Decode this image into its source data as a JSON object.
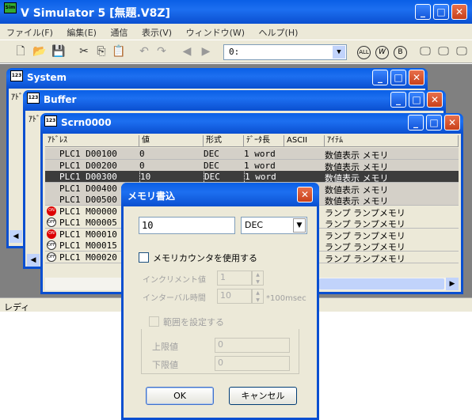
{
  "app": {
    "title": "V Simulator 5 [無題.V8Z]",
    "icon": "Sim"
  },
  "menu": [
    "ファイル(F)",
    "編集(E)",
    "通信",
    "表示(V)",
    "ウィンドウ(W)",
    "ヘルプ(H)"
  ],
  "toolbar": {
    "combo_value": "0:",
    "round_buttons": [
      "ALL",
      "W",
      "B"
    ]
  },
  "windows": {
    "system": "System",
    "buffer": "Buffer",
    "scrn": "Scrn0000"
  },
  "clipped_labels": {
    "system_addr": "ｱﾄﾞ",
    "buffer_addr": "ｱﾄﾞ"
  },
  "table": {
    "headers": [
      "ｱﾄﾞﾚｽ",
      "値",
      "形式",
      "ﾃﾞｰﾀ長",
      "ASCII",
      "ｱｲﾃﾑ"
    ],
    "rows": [
      {
        "addr": "PLC1 D00100",
        "val": "0",
        "fmt": "DEC",
        "len": "1 word",
        "ascii": "",
        "item": "数値表示 メモリ",
        "icon": ""
      },
      {
        "addr": "PLC1 D00200",
        "val": "0",
        "fmt": "DEC",
        "len": "1 word",
        "ascii": "",
        "item": "数値表示 メモリ",
        "icon": ""
      },
      {
        "addr": "PLC1 D00300",
        "val": "10",
        "fmt": "DEC",
        "len": "1 word",
        "ascii": "",
        "item": "数値表示 メモリ",
        "icon": "",
        "selected": true
      },
      {
        "addr": "PLC1 D00400",
        "val": "",
        "fmt": "",
        "len": "",
        "ascii": "",
        "item": "数値表示 メモリ",
        "icon": ""
      },
      {
        "addr": "PLC1 D00500",
        "val": "",
        "fmt": "",
        "len": "",
        "ascii": "",
        "item": "数値表示 メモリ",
        "icon": ""
      },
      {
        "addr": "PLC1 M00000",
        "val": "",
        "fmt": "",
        "len": "",
        "ascii": "",
        "item": "ランプ ランプメモリ",
        "icon": "ON"
      },
      {
        "addr": "PLC1 M00005",
        "val": "",
        "fmt": "",
        "len": "",
        "ascii": "",
        "item": "ランプ ランプメモリ",
        "icon": "OFF"
      },
      {
        "addr": "PLC1 M00010",
        "val": "",
        "fmt": "",
        "len": "",
        "ascii": "",
        "item": "ランプ ランプメモリ",
        "icon": "ON"
      },
      {
        "addr": "PLC1 M00015",
        "val": "",
        "fmt": "",
        "len": "",
        "ascii": "",
        "item": "ランプ ランプメモリ",
        "icon": "OFF"
      },
      {
        "addr": "PLC1 M00020",
        "val": "",
        "fmt": "",
        "len": "",
        "ascii": "",
        "item": "ランプ ランプメモリ",
        "icon": "OFF"
      }
    ]
  },
  "status": "レディ",
  "dialog": {
    "title": "メモリ書込",
    "value": "10",
    "format": "DEC",
    "use_counter_label": "メモリカウンタを使用する",
    "increment_label": "インクリメント値",
    "increment_value": "1",
    "interval_label": "インターバル時間",
    "interval_value": "10",
    "interval_unit": "*100msec",
    "range_label": "範囲を設定する",
    "upper_label": "上限値",
    "upper_value": "0",
    "lower_label": "下限値",
    "lower_value": "0",
    "ok": "OK",
    "cancel": "キャンセル"
  }
}
